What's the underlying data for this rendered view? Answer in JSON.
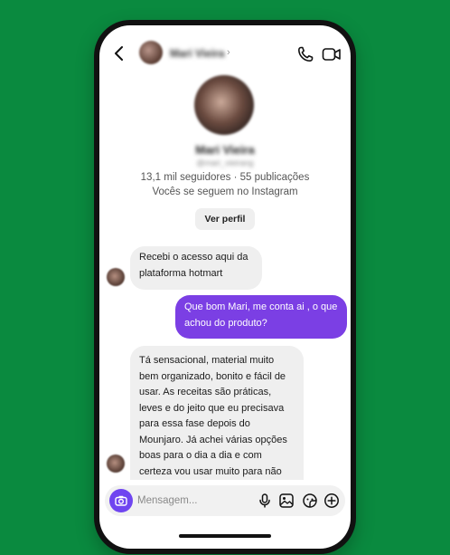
{
  "header": {
    "contact_name": "Mari Vieira",
    "chevron": "›"
  },
  "profile": {
    "name": "Mari Vieira",
    "handle": "@mari_vieirang",
    "stats": "13,1 mil seguidores · 55 publicações",
    "follow_status": "Vocês se seguem no Instagram",
    "view_profile_label": "Ver perfil"
  },
  "messages": [
    {
      "direction": "received",
      "text": "Recebi o acesso aqui da plataforma hotmart"
    },
    {
      "direction": "sent",
      "text": "Que bom Mari, me conta ai , o que achou do produto?"
    },
    {
      "direction": "received",
      "text": "Tá sensacional, material muito bem organizado, bonito e fácil de usar. As receitas são práticas, leves e do jeito que eu precisava para essa fase depois do Mounjaro. Já achei várias opções boas para o dia a dia e com certeza vou usar muito para não ficar perdida na hora de"
    }
  ],
  "composer": {
    "placeholder": "Mensagem..."
  },
  "icons": {
    "back": "back-arrow-icon",
    "phone": "phone-icon",
    "video": "video-icon",
    "camera": "camera-icon",
    "mic": "microphone-icon",
    "gallery": "gallery-icon",
    "sticker": "sticker-icon",
    "add": "plus-icon"
  },
  "colors": {
    "background": "#0a8a3f",
    "sent_bubble": "#7b3fe4",
    "received_bubble": "#efefef",
    "camera_button": "#6f45f0"
  }
}
